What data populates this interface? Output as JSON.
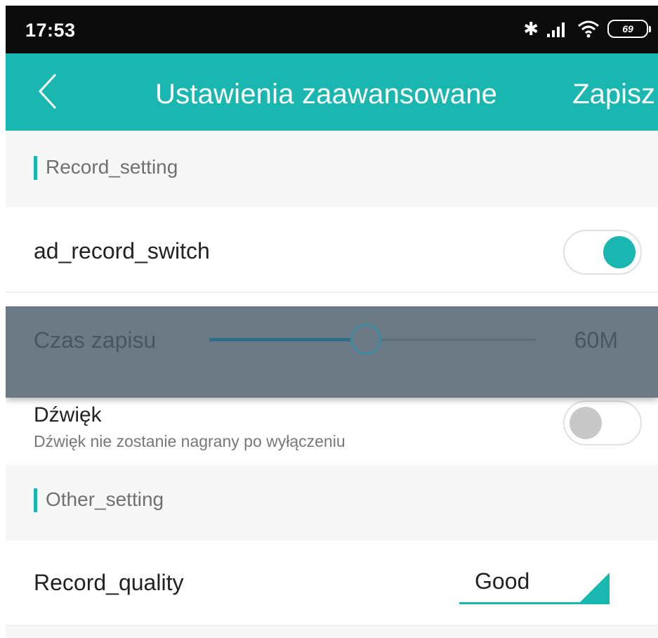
{
  "status_bar": {
    "time": "17:53",
    "icons": [
      "bluetooth-icon",
      "signal-icon",
      "wifi-icon"
    ],
    "battery": "69"
  },
  "header": {
    "back_icon": "chevron-left-icon",
    "title": "Ustawienia zaawansowane",
    "save_label": "Zapisz"
  },
  "sections": {
    "record": {
      "title": "Record_setting",
      "items": {
        "ad_record": {
          "label": "ad_record_switch",
          "enabled": true
        },
        "record_time": {
          "label": "Czas zapisu",
          "value": "60M",
          "level": 0.48
        },
        "sound": {
          "label": "Dźwięk",
          "description": "Dźwięk nie zostanie nagrany po wyłączeniu",
          "enabled": false
        }
      }
    },
    "other": {
      "title": "Other_setting",
      "items": {
        "record_quality": {
          "label": "Record_quality",
          "value": "Good"
        }
      }
    }
  },
  "colors": {
    "accent": "#1ab6b0",
    "status_bar": "#0b0b0b",
    "overlay": "#6c7a86",
    "background": "#f7f7f7"
  }
}
